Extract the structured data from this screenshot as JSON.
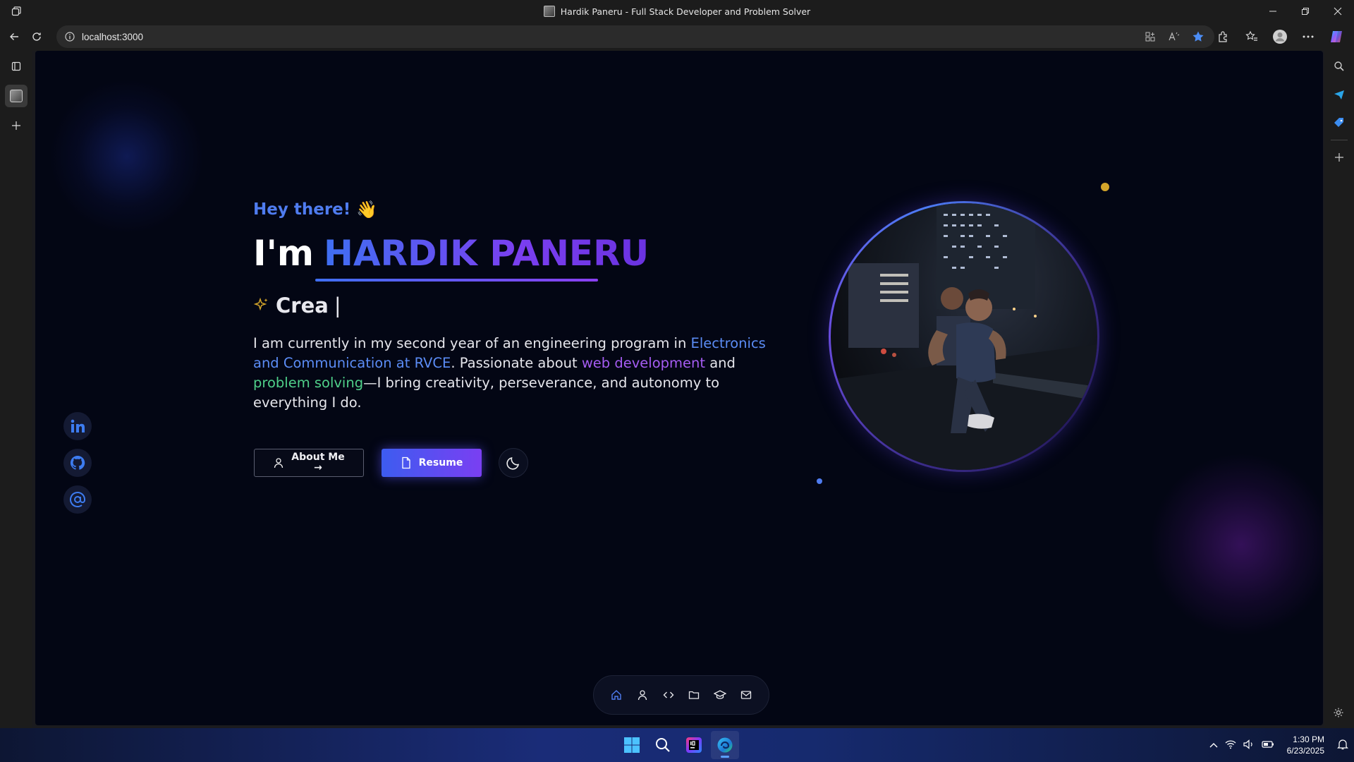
{
  "window": {
    "title": "Hardik Paneru - Full Stack Developer and Problem Solver"
  },
  "browser": {
    "url": "localhost:3000"
  },
  "hero": {
    "greeting": "Hey there!",
    "greeting_emoji": "👋",
    "intro_prefix": "I'm",
    "name": "HARDIK PANERU",
    "typing_text": "Crea",
    "typing_cursor": "|",
    "bio": {
      "part1": "I am currently in my second year of an engineering program in ",
      "highlight1": "Electronics and Communication at RVCE",
      "part2": ". Passionate about ",
      "highlight2": "web development",
      "part3": " and ",
      "highlight3": "problem solving",
      "part4": "—I bring creativity, perseverance, and autonomy to everything I do."
    },
    "buttons": {
      "about_line1": "About Me",
      "about_line2": "→",
      "resume": "Resume"
    }
  },
  "social_links": [
    {
      "icon": "linkedin-icon"
    },
    {
      "icon": "github-icon"
    },
    {
      "icon": "at-sign-icon"
    }
  ],
  "dock": [
    {
      "icon": "home-icon",
      "active": true
    },
    {
      "icon": "user-icon"
    },
    {
      "icon": "code-icon"
    },
    {
      "icon": "folder-icon"
    },
    {
      "icon": "graduation-cap-icon"
    },
    {
      "icon": "mail-icon"
    }
  ],
  "taskbar": {
    "time": "1:30 PM",
    "date": "6/23/2025"
  },
  "colors": {
    "background": "#030614",
    "accent_blue": "#4f7cf0",
    "accent_purple": "#7a3ff0",
    "highlight_green": "#4fd08a",
    "sparkle_gold": "#d4a52a"
  }
}
